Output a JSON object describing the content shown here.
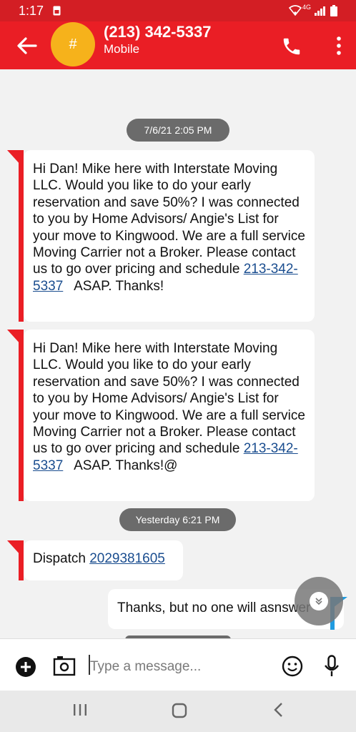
{
  "status_bar": {
    "time": "1:17",
    "network": "4G"
  },
  "header": {
    "avatar_glyph": "#",
    "contact_name": "(213) 342-5337",
    "contact_type": "Mobile"
  },
  "conversation": {
    "date_chip_1": "7/6/21 2:05 PM",
    "message_1": {
      "text": "Hi Dan! Mike here with Interstate Moving LLC. Would you like to do your early reservation and save 50%? I was connected to you by Home Advisors/ Angie's List for your move to Kingwood. We are a full service Moving Carrier not a Broker. Please contact us to go over pricing and schedule ",
      "link": "213-342-5337",
      "suffix": "   ASAP. Thanks!"
    },
    "message_2": {
      "text": "Hi Dan! Mike here with Interstate Moving LLC. Would you like to do your early reservation and save 50%? I was connected to you by Home Advisors/ Angie's List for your move to Kingwood. We are a full service Moving Carrier not a Broker. Please contact us to go over pricing and schedule ",
      "link": "213-342-5337",
      "suffix": "   ASAP. Thanks!@"
    },
    "date_chip_2": "Yesterday 6:21 PM",
    "message_3": {
      "text": "Dispatch ",
      "link": "2029381605"
    },
    "sent_message": "Thanks, but no one will asnswer"
  },
  "composer": {
    "placeholder": "Type a message..."
  },
  "colors": {
    "accent": "#ea1e25",
    "link": "#1a4d8f",
    "avatar": "#f6b21b",
    "chip": "#6b6b6b"
  }
}
